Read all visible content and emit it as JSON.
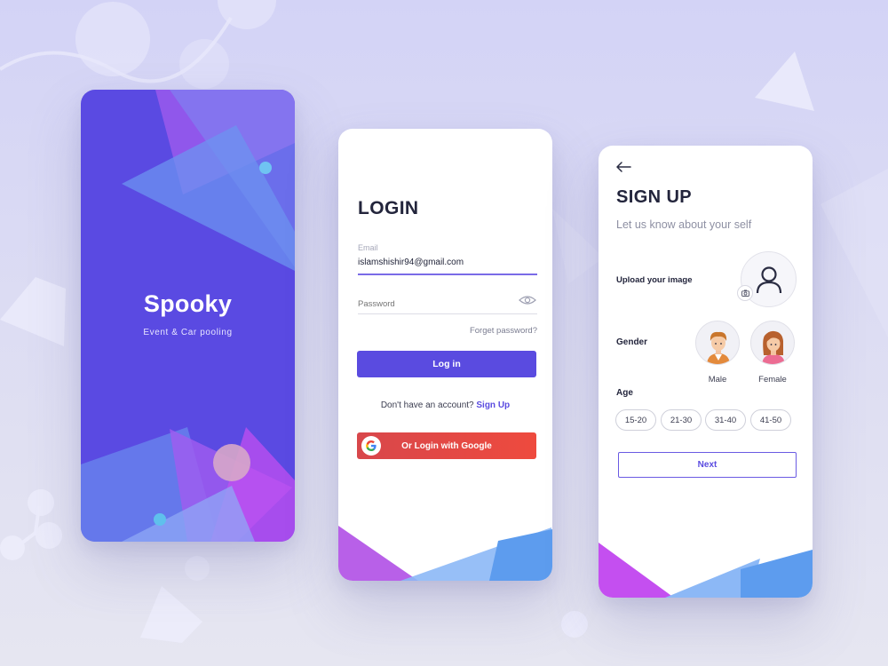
{
  "splash": {
    "title": "Spooky",
    "subtitle": "Event & Car pooling"
  },
  "login": {
    "title": "LOGIN",
    "email": {
      "label": "Email",
      "value": "islamshishir94@gmail.com"
    },
    "password": {
      "placeholder": "Password"
    },
    "forgot_label": "Forget password?",
    "login_button": "Log in",
    "no_account_text": "Don't have an account?",
    "signup_link": "Sign Up",
    "google_button": "Or Login with Google"
  },
  "signup": {
    "title": "SIGN UP",
    "subtitle": "Let us know about your self",
    "upload_label": "Upload your image",
    "gender_label": "Gender",
    "gender_options": [
      "Male",
      "Female"
    ],
    "age_label": "Age",
    "age_options": [
      "15-20",
      "21-30",
      "31-40",
      "41-50"
    ],
    "next_button": "Next"
  },
  "colors": {
    "primary": "#5a4be0",
    "google": "#ea4335",
    "accent_purple": "#c84bf0",
    "accent_blue": "#5f9ef0",
    "background": "#d9d9f4"
  },
  "icons": [
    "back-arrow-icon",
    "eye-icon",
    "google-icon",
    "user-icon",
    "camera-icon",
    "male-avatar-icon",
    "female-avatar-icon"
  ]
}
